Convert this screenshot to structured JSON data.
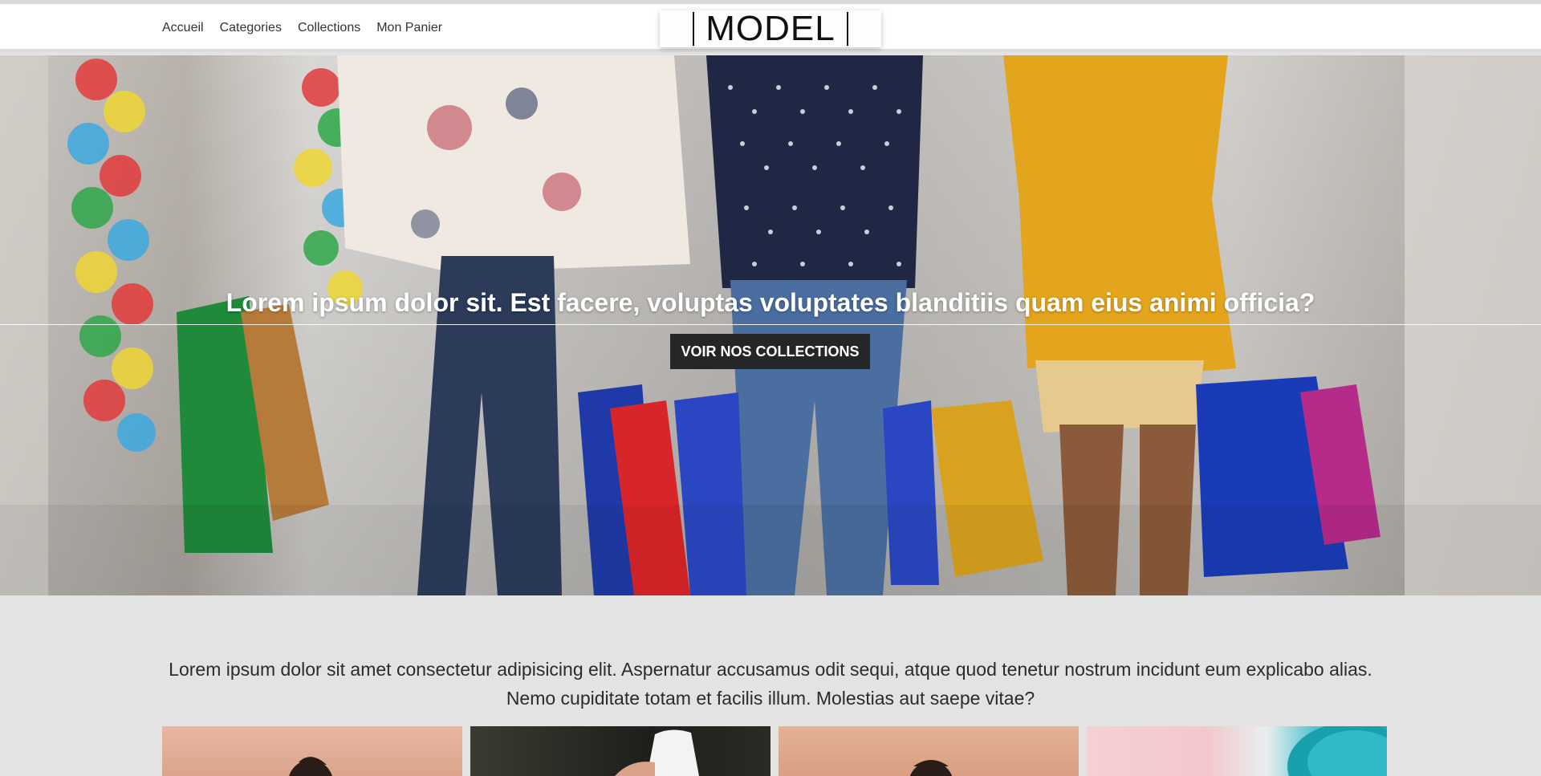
{
  "nav": {
    "items": [
      {
        "label": "Accueil"
      },
      {
        "label": "Categories"
      },
      {
        "label": "Collections"
      },
      {
        "label": "Mon Panier"
      }
    ]
  },
  "brand": {
    "logo": "MODEL"
  },
  "hero": {
    "title": "Lorem ipsum dolor sit. Est facere, voluptas voluptates blanditiis quam eius animi officia?",
    "button_label": "VOIR NOS COLLECTIONS",
    "image": "three-women-shopping-bags-photo"
  },
  "intro": {
    "text": "Lorem ipsum dolor sit amet consectetur adipisicing elit. Aspernatur accusamus odit sequi, atque quod tenetur nostrum incidunt eum explicabo alias. Nemo cupiditate totam et facilis illum. Molestias aut saepe vitae?"
  },
  "products": [
    {
      "image": "model-portrait-photo"
    },
    {
      "image": "white-hat-photo"
    },
    {
      "image": "model-portrait-photo"
    },
    {
      "image": "cosmetic-jar-photo"
    }
  ],
  "colors": {
    "header_bg": "#ffffff",
    "page_bg": "#e3e3e3",
    "button_bg": "#262626",
    "hero_text": "#ffffff"
  }
}
